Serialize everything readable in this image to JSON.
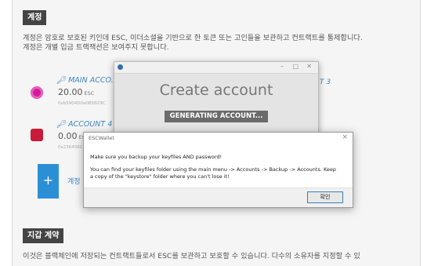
{
  "accounts_section": {
    "title": "계정",
    "description_line1": "계정은 암호로 보호된 키인데 ESC, 이더소셜을 기반으로 한 토큰 또는 고인들을 보관하고 컨트랙트를 통제합니다.",
    "description_line2": "계정은 개별 입금 트랙잭션은 보여주지 못합니다."
  },
  "accounts": [
    {
      "name": "MAIN ACCO...",
      "balance": "20.00",
      "unit": "ESC",
      "address": "0xb5904D0a0B5B29C",
      "icon": "magenta-identicon",
      "color": "#d21a9a"
    },
    {
      "name": "ACCOUNT 4",
      "balance": "0.00",
      "unit": "ESC",
      "address": "0x236456C",
      "icon": "red-invader-identicon",
      "color": "#c81c3a"
    }
  ],
  "other_accounts": [
    {
      "name": "T 3"
    }
  ],
  "add_account": {
    "icon_symbol": "+",
    "label": "계정 추"
  },
  "create_account_window": {
    "heading": "Create account",
    "status": "GENERATING ACCOUNT..."
  },
  "wallet_dialog": {
    "title": "ESCWallet",
    "close_symbol": "×",
    "message_line1": "Make sure you backup your keyfiles AND password!",
    "message_line2": "You can find your keyfiles folder using the main menu -> Accounts -> Backup -> Accounts. Keep",
    "message_line3": "a copy of the \"keystore\" folder where you can't lose it!",
    "ok_label": "확인"
  },
  "contracts_section": {
    "title": "지갑 계약",
    "description": "이것은 블랙체인에 저장되는 컨트랙트들로서 ESC를 보관하고 보호할 수 있습니다. 다수의 소유자를 지정할 수 있"
  }
}
